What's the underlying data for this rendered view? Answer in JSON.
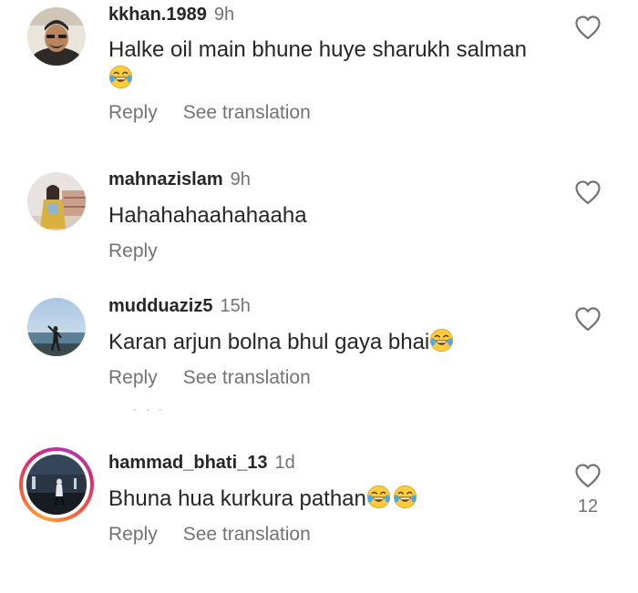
{
  "comments": [
    {
      "username": "kkhan.1989",
      "time": "9h",
      "text_line1": "Halke oil main bhune huye sharukh salman",
      "text_line2": "",
      "emoji": "laughing-tears-emoji",
      "reply_label": "Reply",
      "translate_label": "See translation",
      "likes": ""
    },
    {
      "username": "mahnazislam",
      "time": "9h",
      "text": "Hahahahaahahaaha",
      "reply_label": "Reply",
      "likes": ""
    },
    {
      "username": "mudduaziz5",
      "time": "15h",
      "text": "Karan arjun bolna bhul gaya bhai",
      "emoji": "laughing-tears-emoji",
      "reply_label": "Reply",
      "translate_label": "See translation",
      "likes": ""
    },
    {
      "username": "hammad_bhati_13",
      "time": "1d",
      "text": "Bhuna hua kurkura pathan",
      "emoji": "laughing-tears-emoji",
      "reply_label": "Reply",
      "translate_label": "See translation",
      "likes": "12",
      "has_story_ring": true
    }
  ],
  "icons": {
    "heart": "heart-outline-icon"
  },
  "colors": {
    "text": "#262626",
    "secondary": "#737373",
    "story_ring": [
      "#f9a13a",
      "#d62976",
      "#b33ab4"
    ]
  }
}
